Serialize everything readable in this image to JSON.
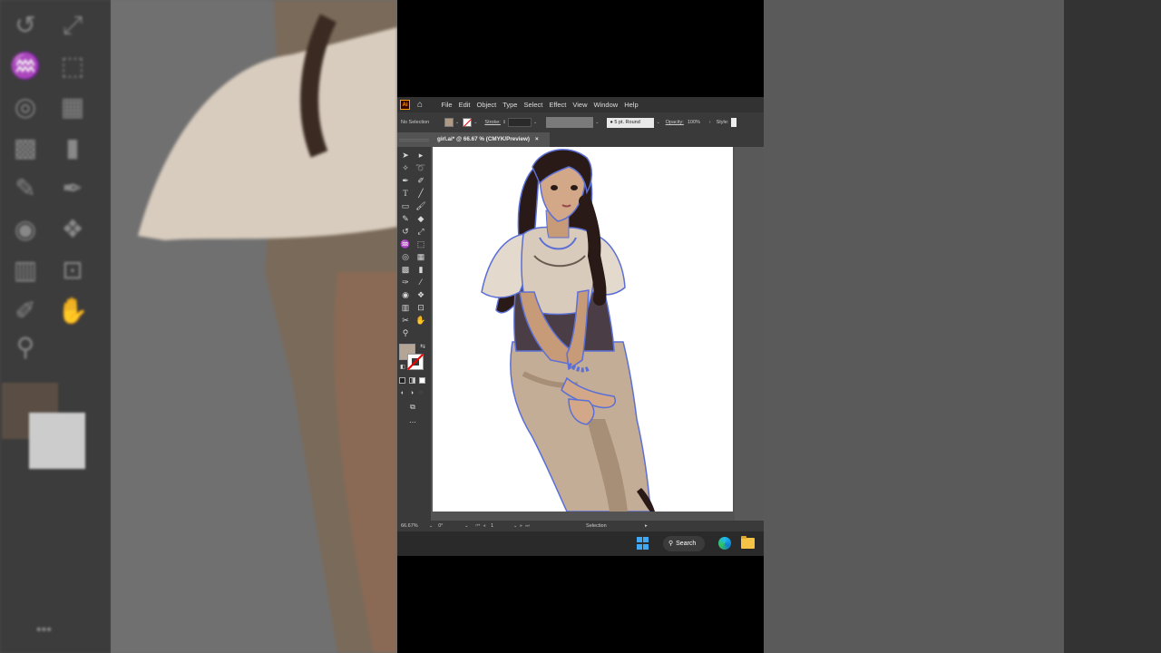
{
  "app": {
    "logo": "Ai",
    "menu": [
      "File",
      "Edit",
      "Object",
      "Type",
      "Select",
      "Effect",
      "View",
      "Window",
      "Help"
    ]
  },
  "control_bar": {
    "selection_label": "No Selection",
    "stroke_label": "Stroke:",
    "brush_value": "5 pt. Round",
    "opacity_label": "Opacity:",
    "opacity_value": "100%",
    "style_label": "Style:"
  },
  "document": {
    "tab_title": "girl.ai* @ 66.67 % (CMYK/Preview)",
    "close_glyph": "×"
  },
  "status_bar": {
    "zoom": "66.67%",
    "rotation": "0°",
    "artboard_number": "1",
    "current_tool": "Selection"
  },
  "taskbar": {
    "search_label": "Search"
  },
  "colors": {
    "fill": "#b5a596",
    "app_bg": "#535353",
    "outline_accent": "#5b6fd6"
  },
  "icons": [
    "selection-tool",
    "direct-selection-tool",
    "magic-wand-tool",
    "lasso-tool",
    "pen-tool",
    "curvature-tool",
    "type-tool",
    "line-tool",
    "rectangle-tool",
    "paintbrush-tool",
    "pencil-tool",
    "eraser-tool",
    "rotate-tool",
    "scale-tool",
    "warp-tool",
    "free-transform-tool",
    "shape-builder-tool",
    "perspective-grid-tool",
    "mesh-tool",
    "gradient-tool",
    "eyedropper-tool",
    "blend-tool",
    "symbol-sprayer-tool",
    "column-graph-tool",
    "artboard-tool",
    "slice-tool",
    "hand-tool",
    "zoom-tool"
  ]
}
